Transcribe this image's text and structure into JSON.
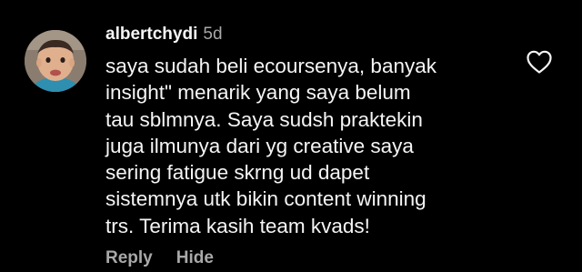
{
  "comment": {
    "username": "albertchydi",
    "timestamp": "5d",
    "text_lines": [
      "saya sudah beli ecoursenya, banyak",
      "insight\" menarik yang saya belum",
      "tau sblmnya. Saya sudsh praktekin",
      "juga ilmunya dari yg creative saya",
      "sering fatigue skrng ud dapet",
      "sistemnya utk bikin content winning",
      "trs. Terima kasih team kvads!"
    ],
    "reply_label": "Reply",
    "hide_label": "Hide",
    "avatar_icon": "user-avatar-photo",
    "like_icon": "heart-outline-icon"
  },
  "colors": {
    "background": "#000000",
    "primary_text": "#f5f5f5",
    "secondary_text": "#a8a8a8"
  }
}
